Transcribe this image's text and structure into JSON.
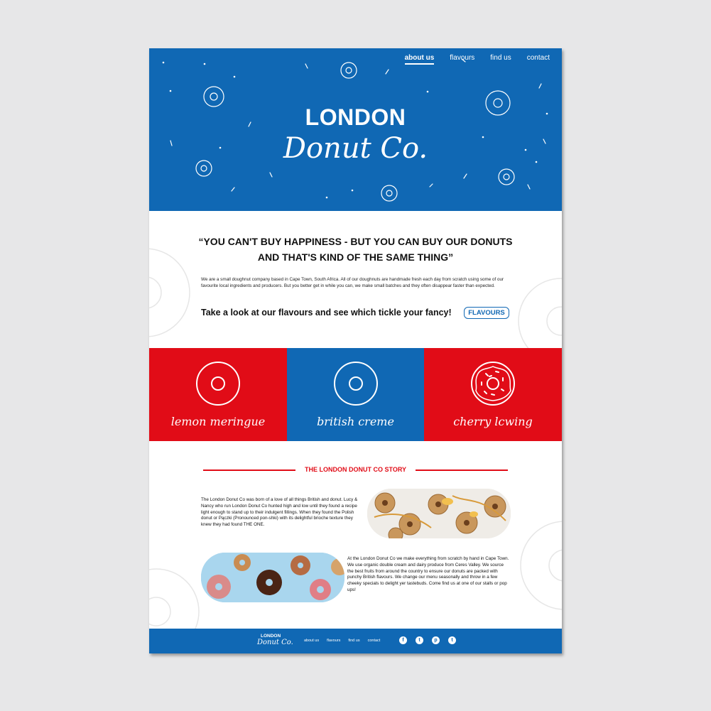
{
  "nav": {
    "items": [
      {
        "label": "about us",
        "active": true
      },
      {
        "label": "flavours",
        "active": false
      },
      {
        "label": "find us",
        "active": false
      },
      {
        "label": "contact",
        "active": false
      }
    ]
  },
  "hero": {
    "logo_top": "LONDON",
    "logo_script": "Donut Co.",
    "background": "#1068b4"
  },
  "intro": {
    "quote": "“YOU CAN'T BUY HAPPINESS - BUT YOU CAN BUY OUR DONUTS AND THAT'S KIND OF THE SAME THING”",
    "paragraph": "We are a small doughnut company based in Cape Town, South Africa. All of our doughnuts are handmade fresh each day from scratch using some of our favourite local ingredients and producers. But you better get in while you can, we make small batches and they often disappear faster than expected.",
    "cta_text": "Take a look at our flavours and see which tickle your fancy!",
    "cta_button": "FLAVOURS"
  },
  "flavours": [
    {
      "label": "lemon meringue",
      "color": "#e10c17",
      "icon": "plain-donut-icon"
    },
    {
      "label": "british creme",
      "color": "#1068b4",
      "icon": "plain-donut-icon"
    },
    {
      "label": "cherry lcwing",
      "color": "#e10c17",
      "icon": "sprinkle-donut-icon"
    }
  ],
  "story": {
    "title": "THE LONDON DONUT CO STORY",
    "paragraph1": "The London Donut Co was born of a love of all things British and donut. Lucy & Nancy who run London Donut Co hunted high and low until they found a recipe light enough to stand up to their indulgent fillings. When they found the Polish donut or Pączki (Pronounced pon-shki) with its delightful brioche texture they knew they had found THE ONE.",
    "paragraph2": "At the London Donut Co we make everything from scratch by hand in Cape Town. We use organic double cream and dairy produce from Ceres Valley. We source the best fruits from around the country to ensure our donuts are packed with punchy British flavours. We change our menu seasonally and throw in a few cheeky specials to delight yer tastebuds. Come find us at one of our stalls or pop ups!",
    "accent": "#e10c17"
  },
  "footer": {
    "logo_top": "LONDON",
    "logo_script": "Donut Co.",
    "nav": [
      "about us",
      "flavours",
      "find us",
      "contact"
    ],
    "social": [
      {
        "icon": "facebook-icon",
        "glyph": "f"
      },
      {
        "icon": "twitter-icon",
        "glyph": "t"
      },
      {
        "icon": "pinterest-icon",
        "glyph": "p"
      },
      {
        "icon": "tumblr-icon",
        "glyph": "t"
      }
    ]
  }
}
